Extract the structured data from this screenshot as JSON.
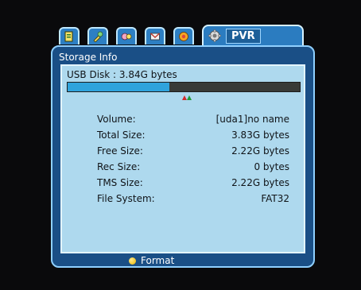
{
  "tabs": {
    "items": [
      {
        "icon": "settings-icon"
      },
      {
        "icon": "tools-icon"
      },
      {
        "icon": "channels-icon"
      },
      {
        "icon": "mail-icon"
      },
      {
        "icon": "media-icon"
      }
    ],
    "active": {
      "icon": "pvr-gear-icon",
      "label": "PVR"
    }
  },
  "panel": {
    "title": "Storage Info",
    "disk_label": "USB Disk : 3.84G bytes",
    "usage_fraction": 0.44,
    "rows": [
      {
        "key": "Volume:",
        "value": "[uda1]no name"
      },
      {
        "key": "Total Size:",
        "value": "3.83G bytes"
      },
      {
        "key": "Free Size:",
        "value": "2.22G bytes"
      },
      {
        "key": "Rec Size:",
        "value": "0 bytes"
      },
      {
        "key": "TMS Size:",
        "value": "2.22G bytes"
      },
      {
        "key": "File System:",
        "value": "FAT32"
      }
    ],
    "footer": {
      "button_color": "yellow",
      "label": "Format"
    }
  },
  "colors": {
    "panel_bg": "#1a4f86",
    "inner_bg": "#aed9ee",
    "bar_fill": "#2fa3dc",
    "bar_empty": "#383a37",
    "yellow": "#e9b600"
  }
}
